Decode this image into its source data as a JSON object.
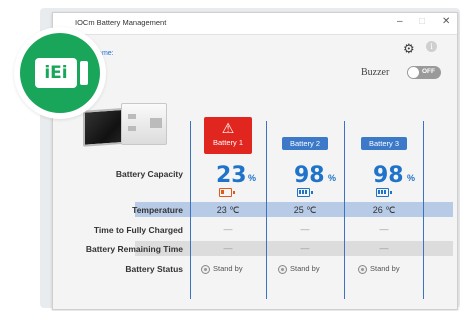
{
  "window": {
    "title": "IOCm Battery Management",
    "minimize": "–",
    "maximize": "□",
    "close": "✕"
  },
  "header": {
    "name_label": "Name:",
    "gear_icon": "⚙",
    "info_icon": "i",
    "buzzer_label": "Buzzer",
    "buzzer_state": "OFF"
  },
  "logo": {
    "text": "iEi"
  },
  "batteries": [
    {
      "label": "Battery 1",
      "capacity": "23",
      "unit": "%",
      "temperature": "23 ℃",
      "time_to_full": "—",
      "remaining": "—",
      "status": "Stand by",
      "alert": true,
      "color": "#e0261f"
    },
    {
      "label": "Battery 2",
      "capacity": "98",
      "unit": "%",
      "temperature": "25 ℃",
      "time_to_full": "—",
      "remaining": "—",
      "status": "Stand by",
      "alert": false,
      "color": "#3c79c9"
    },
    {
      "label": "Battery 3",
      "capacity": "98",
      "unit": "%",
      "temperature": "26 ℃",
      "time_to_full": "—",
      "remaining": "—",
      "status": "Stand by",
      "alert": false,
      "color": "#3c79c9"
    }
  ],
  "rows": {
    "capacity": "Battery Capacity",
    "temperature": "Temperature",
    "time_to_full": "Time to Fully Charged",
    "remaining": "Battery Remaining Time",
    "status": "Battery Status"
  },
  "colors": {
    "accent": "#1f73c9",
    "alert": "#e0261f",
    "logo_green": "#1aa65a"
  }
}
